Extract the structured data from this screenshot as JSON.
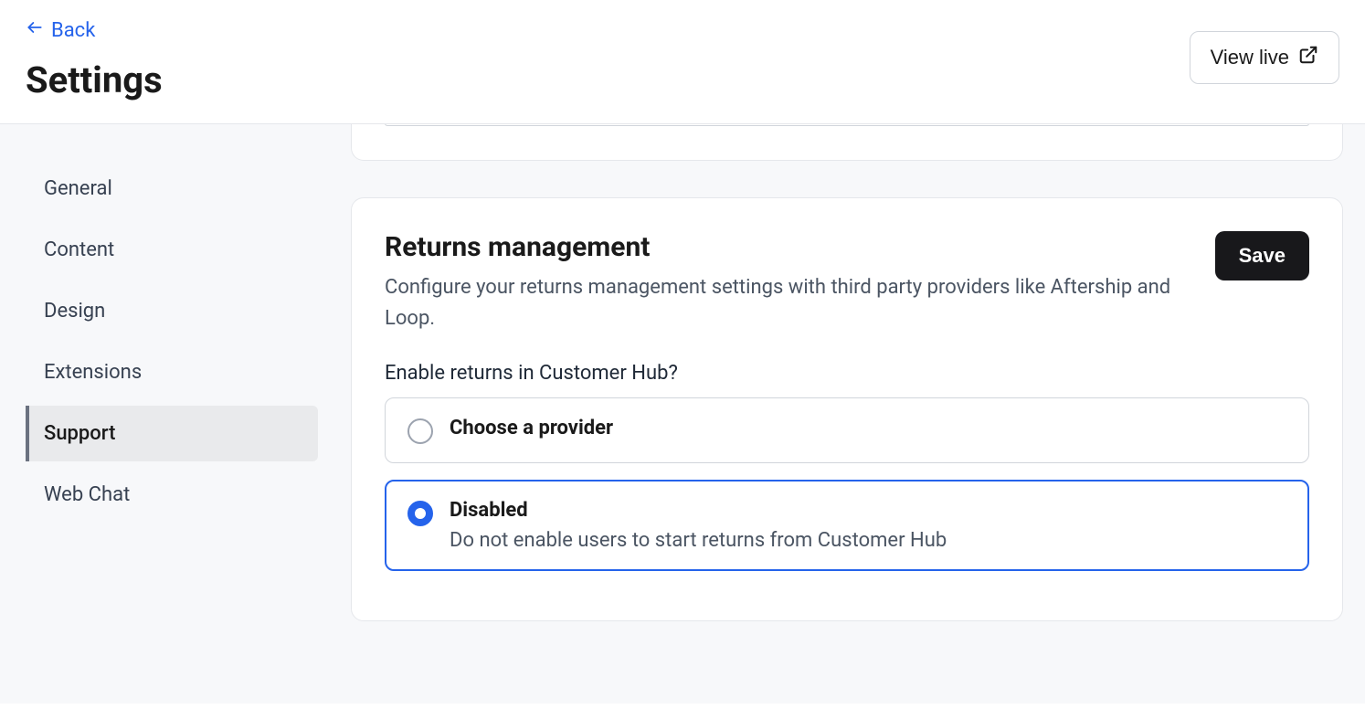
{
  "header": {
    "back_label": "Back",
    "title": "Settings",
    "view_live_label": "View live"
  },
  "sidebar": {
    "items": [
      {
        "label": "General",
        "active": false
      },
      {
        "label": "Content",
        "active": false
      },
      {
        "label": "Design",
        "active": false
      },
      {
        "label": "Extensions",
        "active": false
      },
      {
        "label": "Support",
        "active": true
      },
      {
        "label": "Web Chat",
        "active": false
      }
    ]
  },
  "main": {
    "card": {
      "title": "Returns management",
      "description": "Configure your returns management settings with third party providers like Aftership and Loop.",
      "save_label": "Save",
      "field_label": "Enable returns in Customer Hub?",
      "options": [
        {
          "title": "Choose a provider",
          "description": "",
          "selected": false
        },
        {
          "title": "Disabled",
          "description": "Do not enable users to start returns from Customer Hub",
          "selected": true
        }
      ]
    }
  }
}
